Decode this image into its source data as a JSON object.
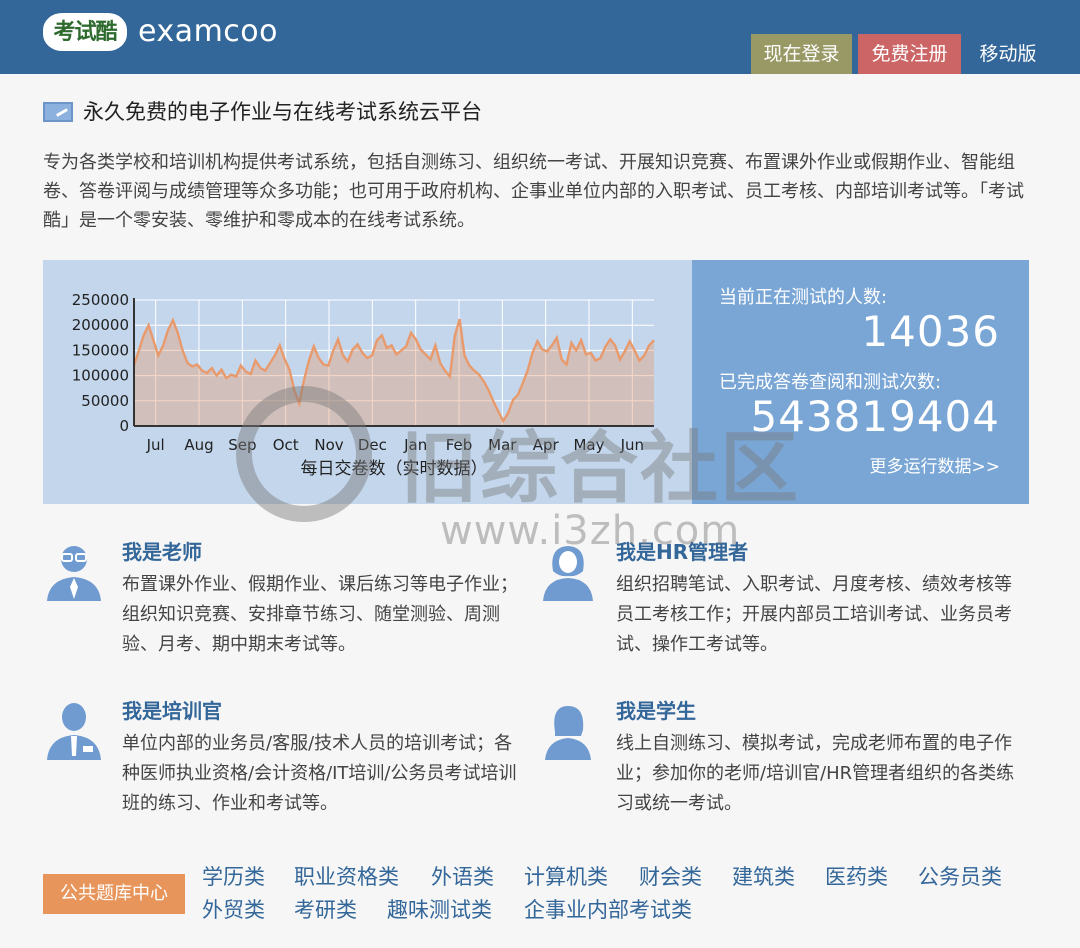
{
  "header": {
    "logo_mark": "考试酷",
    "logo_text": "examcoo",
    "login_label": "现在登录",
    "register_label": "免费注册",
    "mobile_label": "移动版",
    "colors": {
      "bar": "#336699",
      "login": "#999966",
      "register": "#cc6666"
    }
  },
  "main": {
    "title": "永久免费的电子作业与在线考试系统云平台",
    "intro": "专为各类学校和培训机构提供考试系统，包括自测练习、组织统一考试、开展知识竞赛、布置课外作业或假期作业、智能组卷、答卷评阅与成绩管理等众多功能；也可用于政府机构、企事业单位内部的入职考试、员工考核、内部培训考试等。「考试酷」是一个零安装、零维护和零成本的在线考试系统。"
  },
  "stats": {
    "label_current": "当前正在测试的人数:",
    "current_count": "14036",
    "label_completed": "已完成答卷查阅和测试次数:",
    "completed_count": "543819404",
    "more_link": "更多运行数据>>"
  },
  "chart_data": {
    "type": "area",
    "title": "",
    "xlabel": "每日交卷数（实时数据）",
    "ylabel": "",
    "ylim": [
      0,
      250000
    ],
    "y_ticks": [
      "250000",
      "200000",
      "150000",
      "100000",
      "50000",
      "0"
    ],
    "x_ticks": [
      "Jul",
      "Aug",
      "Sep",
      "Oct",
      "Nov",
      "Dec",
      "Jan",
      "Feb",
      "Mar",
      "Apr",
      "May",
      "Jun"
    ],
    "grid": true,
    "legend": "none",
    "series": [
      {
        "values": [
          120000,
          150000,
          180000,
          200000,
          170000,
          140000,
          160000,
          190000,
          210000,
          185000,
          150000,
          125000,
          118000,
          122000,
          110000,
          105000,
          115000,
          100000,
          112000,
          95000,
          102000,
          98000,
          120000,
          108000,
          103000,
          130000,
          115000,
          110000,
          125000,
          140000,
          160000,
          132000,
          112000,
          70000,
          45000,
          92000,
          130000,
          158000,
          135000,
          122000,
          120000,
          150000,
          172000,
          140000,
          128000,
          152000,
          162000,
          145000,
          135000,
          140000,
          170000,
          180000,
          155000,
          160000,
          142000,
          150000,
          158000,
          185000,
          172000,
          152000,
          142000,
          132000,
          160000,
          125000,
          110000,
          98000,
          178000,
          212000,
          140000,
          120000,
          110000,
          102000,
          88000,
          70000,
          48000,
          28000,
          10000,
          26000,
          52000,
          62000,
          85000,
          110000,
          145000,
          168000,
          152000,
          148000,
          160000,
          175000,
          132000,
          122000,
          165000,
          150000,
          170000,
          142000,
          145000,
          130000,
          135000,
          158000,
          172000,
          160000,
          132000,
          148000,
          168000,
          150000,
          130000,
          140000,
          160000,
          170000
        ],
        "color": "#e89a6c"
      }
    ]
  },
  "roles": [
    {
      "title": "我是老师",
      "desc": "布置课外作业、假期作业、课后练习等电子作业；组织知识竞赛、安排章节练习、随堂测验、周测验、月考、期中期末考试等。",
      "icon": "teacher-icon"
    },
    {
      "title": "我是HR管理者",
      "desc": "组织招聘笔试、入职考试、月度考核、绩效考核等员工考核工作；开展内部员工培训考试、业务员考试、操作工考试等。",
      "icon": "hr-manager-icon"
    },
    {
      "title": "我是培训官",
      "desc": "单位内部的业务员/客服/技术人员的培训考试；各种医师执业资格/会计资格/IT培训/公务员考试培训班的练习、作业和考试等。",
      "icon": "trainer-icon"
    },
    {
      "title": "我是学生",
      "desc": "线上自测练习、模拟考试，完成老师布置的电子作业；参加你的老师/培训官/HR管理者组织的各类练习或统一考试。",
      "icon": "student-icon"
    }
  ],
  "question_bank": {
    "button_label": "公共题库中心",
    "links": [
      "学历类",
      "职业资格类",
      "外语类",
      "计算机类",
      "财会类",
      "建筑类",
      "医药类",
      "公务员类",
      "外贸类",
      "考研类",
      "趣味测试类",
      "企事业内部考试类"
    ]
  },
  "watermark": {
    "cn": "旧综合社区",
    "url": "www.i3zh.com"
  }
}
